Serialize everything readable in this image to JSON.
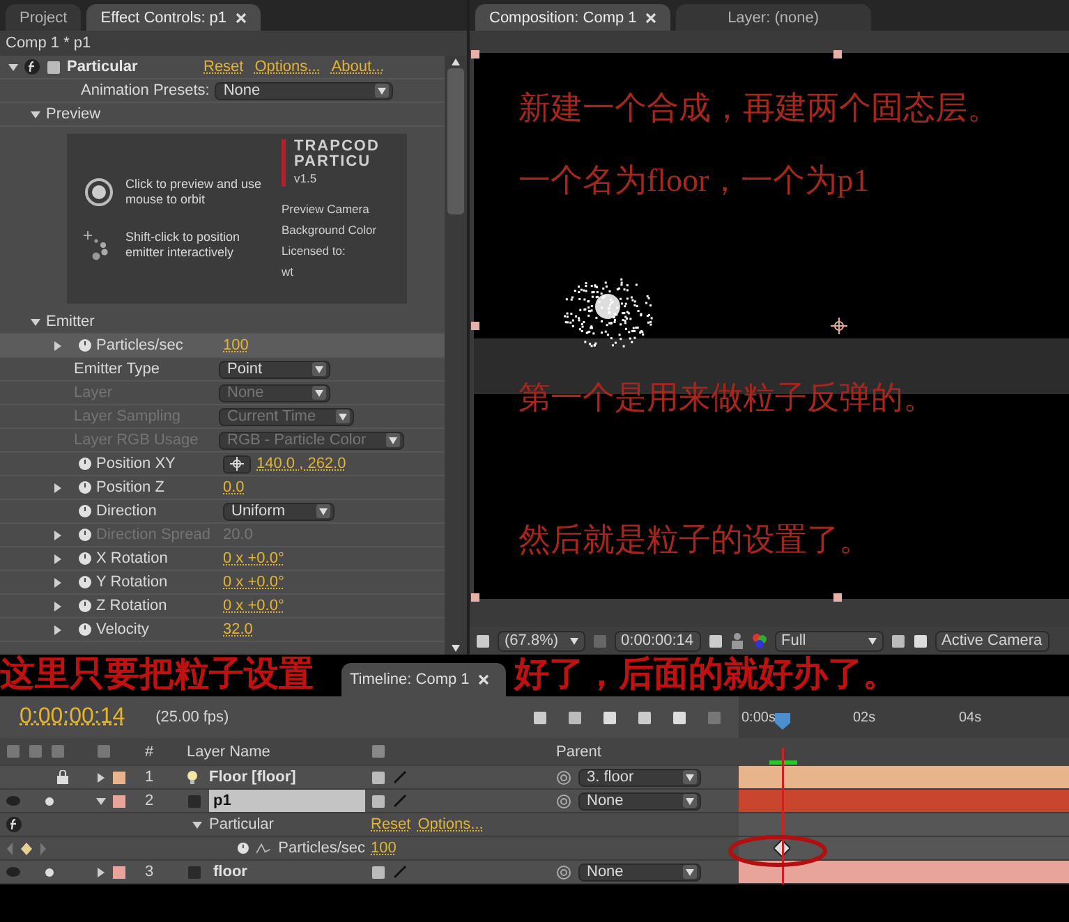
{
  "effect_panel": {
    "tabs": [
      {
        "label": "Project",
        "selected": false
      },
      {
        "label": "Effect Controls: p1",
        "selected": true
      }
    ],
    "subtitle": "Comp 1 * p1",
    "effect": {
      "name": "Particular",
      "expanded": true,
      "links": [
        "Reset",
        "Options...",
        "About..."
      ]
    },
    "presets": {
      "label": "Animation Presets:",
      "value": "None"
    },
    "preview": {
      "label": "Preview",
      "expanded": true,
      "hints": [
        "Click to preview and use mouse to orbit",
        "Shift-click to position emitter interactively"
      ],
      "logo": [
        "TRAPCOD",
        "PARTICU"
      ],
      "version": "v1.5",
      "info": [
        "Preview Camera",
        "Background Color",
        "Licensed to:",
        "wt"
      ]
    },
    "emitter": {
      "label": "Emitter",
      "expanded": true,
      "params": [
        {
          "name": "Particles/sec",
          "kind": "number",
          "value": "100",
          "twirl": true,
          "stopwatch": true,
          "disabled": false,
          "selected": true
        },
        {
          "name": "Emitter Type",
          "kind": "dropdown",
          "value": "Point",
          "twirl": false,
          "stopwatch": false,
          "disabled": false,
          "selected": false
        },
        {
          "name": "Layer",
          "kind": "dropdown",
          "value": "None",
          "twirl": false,
          "stopwatch": false,
          "disabled": true,
          "selected": false
        },
        {
          "name": "Layer Sampling",
          "kind": "dropdown",
          "value": "Current Time",
          "twirl": false,
          "stopwatch": false,
          "disabled": true,
          "selected": false
        },
        {
          "name": "Layer RGB Usage",
          "kind": "dropdown",
          "value": "RGB - Particle Color",
          "twirl": false,
          "stopwatch": false,
          "disabled": true,
          "selected": false
        },
        {
          "name": "Position XY",
          "kind": "point",
          "value": "140.0 , 262.0",
          "twirl": false,
          "stopwatch": true,
          "disabled": false,
          "selected": false
        },
        {
          "name": "Position Z",
          "kind": "number",
          "value": "0.0",
          "twirl": true,
          "stopwatch": true,
          "disabled": false,
          "selected": false
        },
        {
          "name": "Direction",
          "kind": "dropdown",
          "value": "Uniform",
          "twirl": false,
          "stopwatch": true,
          "disabled": false,
          "selected": false
        },
        {
          "name": "Direction Spread",
          "kind": "number",
          "value": "20.0",
          "twirl": true,
          "stopwatch": true,
          "disabled": true,
          "selected": false
        },
        {
          "name": "X Rotation",
          "kind": "number",
          "value": "0 x +0.0°",
          "twirl": true,
          "stopwatch": true,
          "disabled": false,
          "selected": false
        },
        {
          "name": "Y Rotation",
          "kind": "number",
          "value": "0 x +0.0°",
          "twirl": true,
          "stopwatch": true,
          "disabled": false,
          "selected": false
        },
        {
          "name": "Z Rotation",
          "kind": "number",
          "value": "0 x +0.0°",
          "twirl": true,
          "stopwatch": true,
          "disabled": false,
          "selected": false
        },
        {
          "name": "Velocity",
          "kind": "number",
          "value": "32.0",
          "twirl": true,
          "stopwatch": true,
          "disabled": false,
          "selected": false
        }
      ]
    }
  },
  "comp_panel": {
    "tabs": [
      {
        "label": "Composition: Comp 1",
        "selected": true
      },
      {
        "label": "Layer: (none)",
        "selected": false
      }
    ],
    "captions": [
      "新建一个合成，再建两个固态层。",
      "一个名为floor，一个为p1",
      "第一个是用来做粒子反弹的。",
      "然后就是粒子的设置了。"
    ],
    "toolbar": {
      "zoom": "(67.8%)",
      "time": "0:00:00:14",
      "resolution": "Full",
      "camera": "Active Camera"
    }
  },
  "annotations": [
    "这里只要把粒子设置",
    "好了，后面的就好办了。"
  ],
  "timeline": {
    "tab": "Timeline: Comp 1",
    "time": "0:00:00:14",
    "fps": "(25.00 fps)",
    "columns": [
      "#",
      "Layer Name",
      "Parent"
    ],
    "ruler": [
      "0:00s",
      "02s",
      "04s"
    ],
    "rows": [
      {
        "kind": "light",
        "number": "1",
        "name": "Floor [floor]",
        "color": "#e8b48c",
        "visible": false,
        "locked": true,
        "expanded": false,
        "selected": false,
        "parent": "3. floor"
      },
      {
        "kind": "solid",
        "number": "2",
        "name": "p1",
        "color": "#e8a49a",
        "visible": true,
        "locked": false,
        "expanded": true,
        "selected": true,
        "parent": "None"
      },
      {
        "kind": "effect",
        "name": "Particular",
        "expanded": true,
        "links": [
          "Reset",
          "Options..."
        ]
      },
      {
        "kind": "property",
        "name": "Particles/sec",
        "value": "100",
        "keyframe": true
      },
      {
        "kind": "solid",
        "number": "3",
        "name": "floor",
        "color": "#e8a49a",
        "visible": true,
        "locked": false,
        "expanded": false,
        "selected": false,
        "parent": "None"
      }
    ]
  }
}
